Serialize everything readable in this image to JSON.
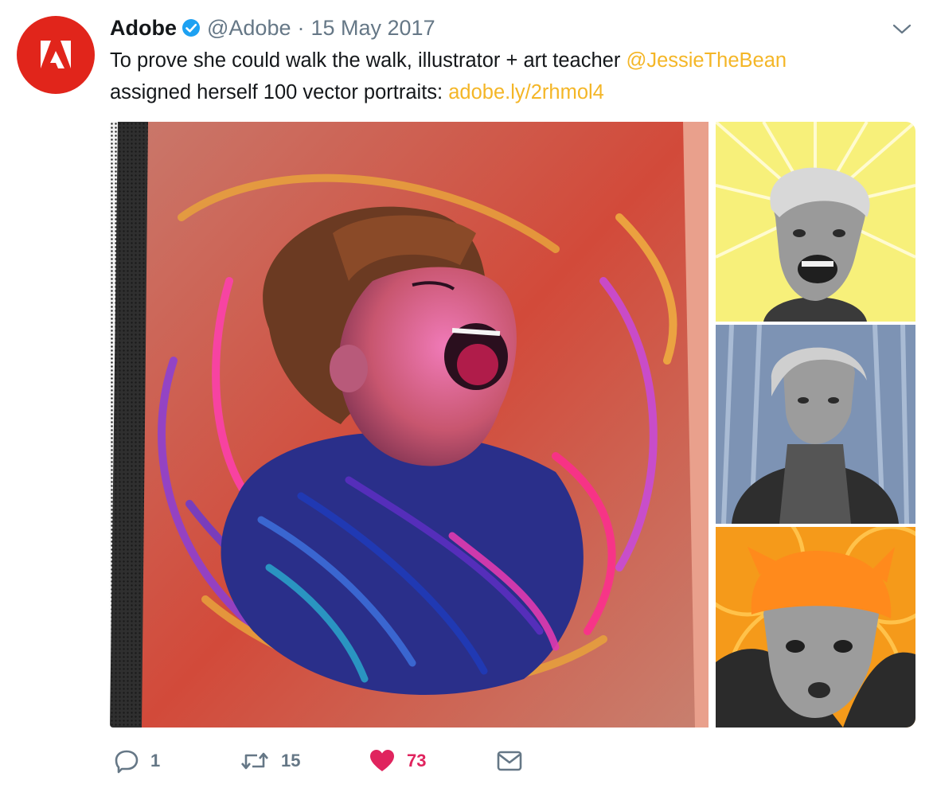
{
  "tweet": {
    "author_name": "Adobe",
    "handle": "@Adobe",
    "separator": "·",
    "date": "15 May 2017",
    "text_part1": "To prove she could walk the walk, illustrator + art teacher ",
    "mention": "@JessieTheBean",
    "text_part2": "assigned herself 100 vector portraits: ",
    "link": "adobe.ly/2rhmol4"
  },
  "media": [
    {
      "icon": "portrait-illustration-screaming-woman"
    },
    {
      "icon": "portrait-illustration-laughing-man"
    },
    {
      "icon": "portrait-illustration-woman-cardigan"
    },
    {
      "icon": "portrait-illustration-man-orange-beanie"
    }
  ],
  "actions": {
    "reply_count": "1",
    "retweet_count": "15",
    "like_count": "73"
  },
  "colors": {
    "adobe_red": "#e1251b",
    "accent": "#f4b627",
    "verified": "#1da1f2",
    "like": "#e0245e",
    "muted": "#657786"
  }
}
